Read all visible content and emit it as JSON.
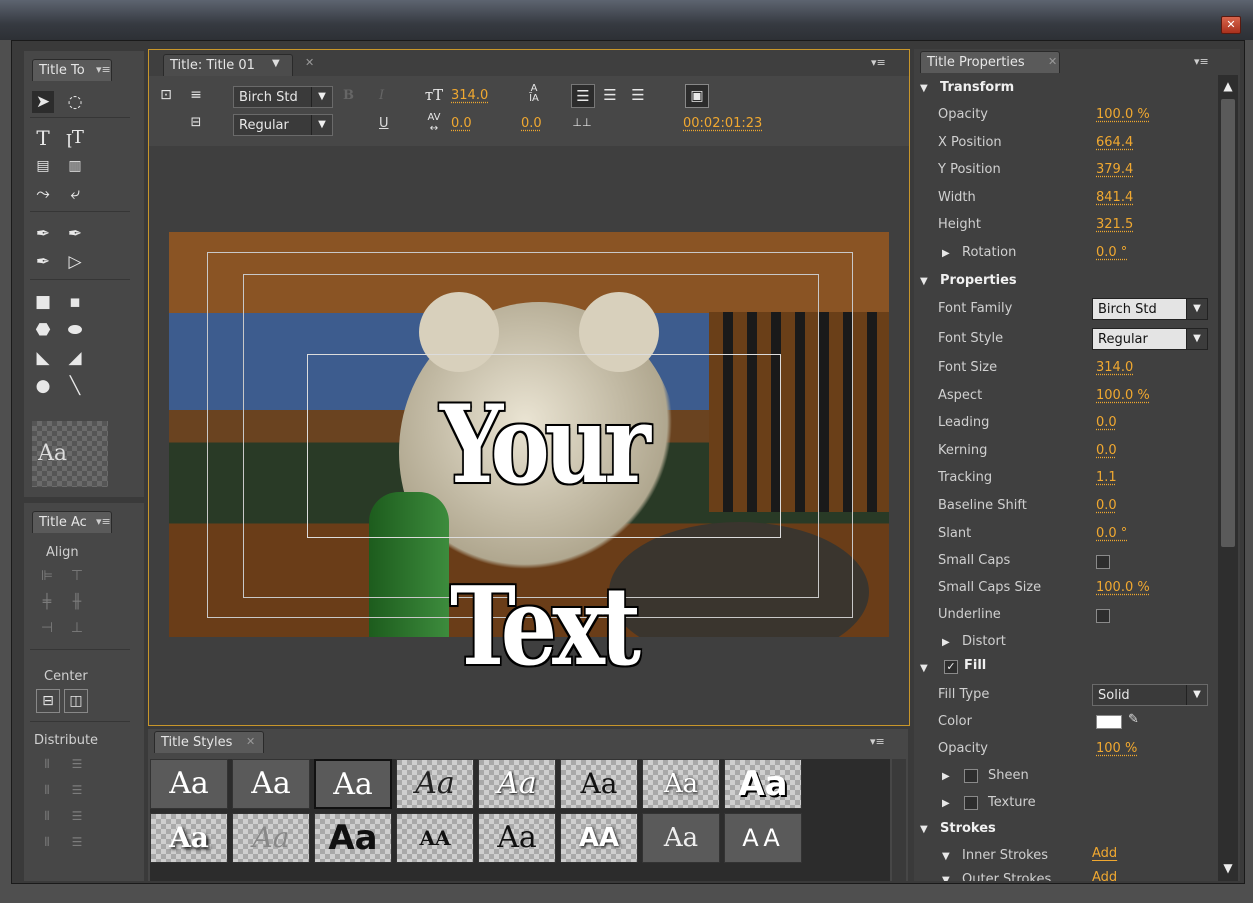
{
  "window": {
    "close_icon": "close-icon"
  },
  "tools_panel": {
    "title": "Title To",
    "style_preview": "Aa"
  },
  "actions_panel": {
    "title": "Title Ac",
    "align": "Align",
    "center": "Center",
    "distribute": "Distribute"
  },
  "designer": {
    "tab": "Title: Title 01",
    "font_family": "Birch Std",
    "font_style": "Regular",
    "bold": "B",
    "italic": "I",
    "underline": "U",
    "font_size": "314.0",
    "kerning": "0.0",
    "leading": "0.0",
    "timecode": "00:02:01:23",
    "canvas_text": "Your Text"
  },
  "styles_panel": {
    "title": "Title Styles",
    "row1": [
      "Aa",
      "Aa",
      "Aa",
      "Aa",
      "Aa",
      "Aa",
      "Aa",
      "Aa"
    ],
    "row2": [
      "Aa",
      "Aa",
      "Aa",
      "AA",
      "Aa",
      "AA",
      "Aa",
      "AA"
    ]
  },
  "properties": {
    "title": "Title Properties",
    "transform": {
      "header": "Transform",
      "opacity_label": "Opacity",
      "opacity": "100.0 %",
      "x_label": "X Position",
      "x": "664.4",
      "y_label": "Y Position",
      "y": "379.4",
      "width_label": "Width",
      "width": "841.4",
      "height_label": "Height",
      "height": "321.5",
      "rotation_label": "Rotation",
      "rotation": "0.0 °"
    },
    "props": {
      "header": "Properties",
      "font_family_label": "Font Family",
      "font_family": "Birch Std",
      "font_style_label": "Font Style",
      "font_style": "Regular",
      "font_size_label": "Font Size",
      "font_size": "314.0",
      "aspect_label": "Aspect",
      "aspect": "100.0 %",
      "leading_label": "Leading",
      "leading": "0.0",
      "kerning_label": "Kerning",
      "kerning": "0.0",
      "tracking_label": "Tracking",
      "tracking": "1.1",
      "baseline_label": "Baseline Shift",
      "baseline": "0.0",
      "slant_label": "Slant",
      "slant": "0.0 °",
      "small_caps_label": "Small Caps",
      "small_caps_size_label": "Small Caps Size",
      "small_caps_size": "100.0 %",
      "underline_label": "Underline",
      "distort_label": "Distort"
    },
    "fill": {
      "header": "Fill",
      "fill_type_label": "Fill Type",
      "fill_type": "Solid",
      "color_label": "Color",
      "color_value": "#ffffff",
      "opacity_label": "Opacity",
      "opacity": "100 %",
      "sheen_label": "Sheen",
      "texture_label": "Texture"
    },
    "strokes": {
      "header": "Strokes",
      "inner_label": "Inner Strokes",
      "inner_add": "Add",
      "outer_label": "Outer Strokes",
      "outer_add": "Add"
    }
  },
  "colors": {
    "accent": "#f0a830",
    "frame": "#c8962a"
  }
}
